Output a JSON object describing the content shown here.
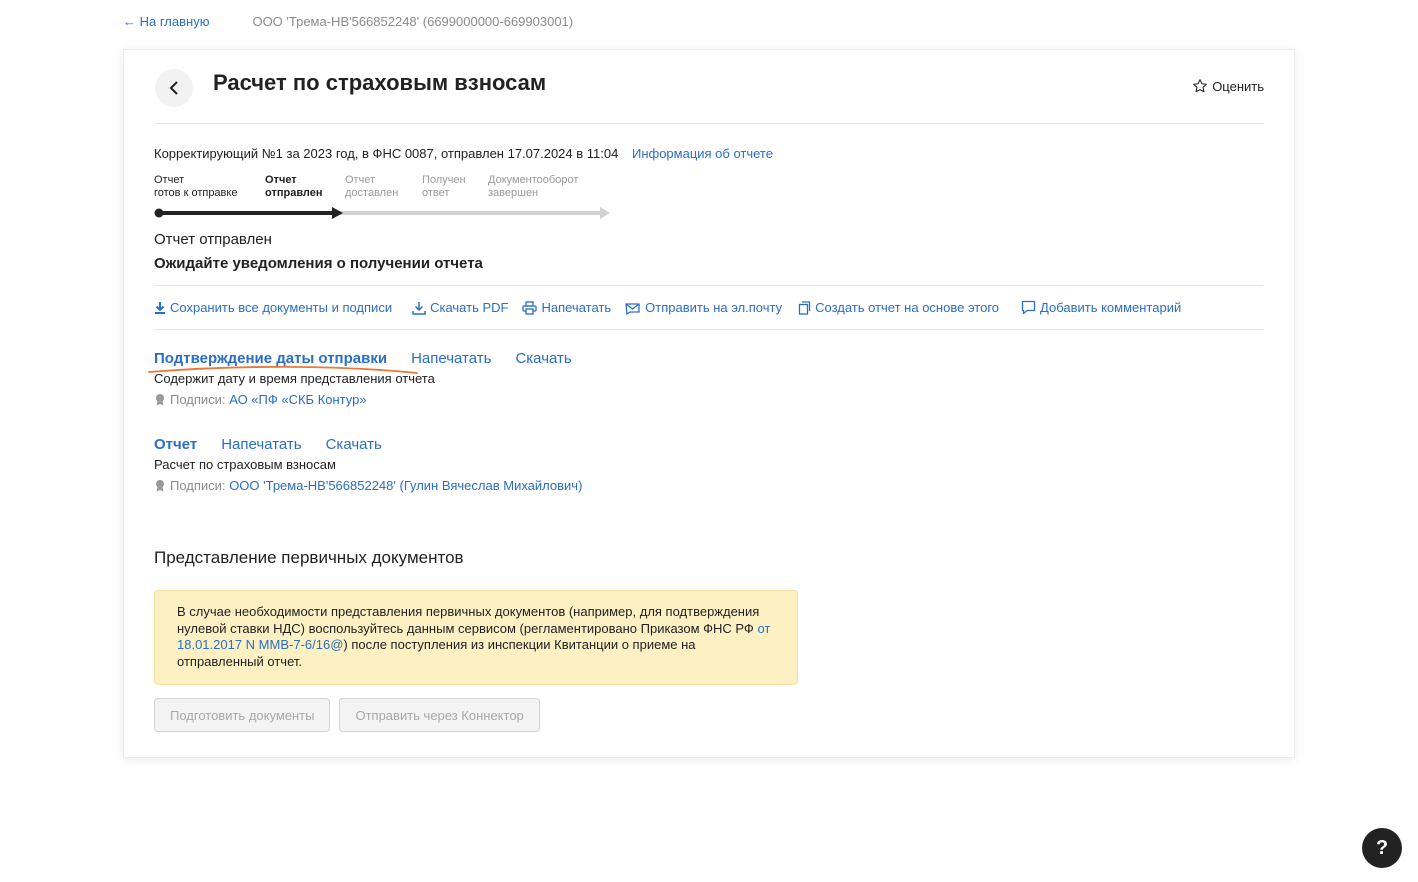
{
  "topbar": {
    "back_label": "← На главную",
    "org": "ООО 'Трема-НВ'566852248' (6699000000-669903001)"
  },
  "header": {
    "title": "Расчет по страховым взносам",
    "rate_label": "Оценить"
  },
  "meta": {
    "text": "Корректирующий №1 за 2023 год, в ФНС 0087, отправлен 17.07.2024 в 11:04",
    "info_link": "Информация об отчете"
  },
  "steps": [
    {
      "line1": "Отчет",
      "line2": "готов к отправке",
      "state": "done"
    },
    {
      "line1": "Отчет",
      "line2": "отправлен",
      "state": "current"
    },
    {
      "line1": "Отчет",
      "line2": "доставлен",
      "state": "pending"
    },
    {
      "line1": "Получен",
      "line2": "ответ",
      "state": "pending"
    },
    {
      "line1": "Документооборот",
      "line2": "завершен",
      "state": "pending"
    }
  ],
  "status": {
    "line1": "Отчет отправлен",
    "line2": "Ожидайте уведомления о получении отчета"
  },
  "actions": [
    {
      "label": "Сохранить все документы и подписи",
      "icon": "download-icon"
    },
    {
      "label": "Скачать PDF",
      "icon": "download-pdf-icon"
    },
    {
      "label": "Напечатать",
      "icon": "printer-icon"
    },
    {
      "label": "Отправить на эл.почту",
      "icon": "mail-icon"
    },
    {
      "label": "Создать отчет на основе этого",
      "icon": "copy-icon"
    },
    {
      "label": "Добавить комментарий",
      "icon": "comment-icon"
    }
  ],
  "docs": [
    {
      "title": "Подтверждение даты отправки",
      "print": "Напечатать",
      "download": "Скачать",
      "desc": "Содержит дату и время представления отчета",
      "sign_label": "Подписи:",
      "sign_value": "АО «ПФ «СКБ Контур»"
    },
    {
      "title": "Отчет",
      "print": "Напечатать",
      "download": "Скачать",
      "desc": "Расчет по страховым взносам",
      "sign_label": "Подписи:",
      "sign_value": "ООО 'Трема-НВ'566852248' (Гулин Вячеслав Михайлович)"
    }
  ],
  "primary_docs": {
    "title": "Представление первичных документов",
    "notice_part1": "В случае необходимости представления первичных документов (например, для подтверждения нулевой ставки НДС) воспользуйтесь данным сервисом (регламентировано Приказом ФНС РФ ",
    "notice_link": "от 18.01.2017 N ММВ-7-6/16@",
    "notice_part2": ") после поступления из инспекции Квитанции о приеме на отправленный отчет.",
    "btn_prepare": "Подготовить документы",
    "btn_send": "Отправить через Коннектор"
  },
  "help": {
    "label": "?"
  },
  "colors": {
    "link": "#2a6ec7",
    "notice_bg": "#fdf1c4",
    "annotation": "#e8793a"
  }
}
